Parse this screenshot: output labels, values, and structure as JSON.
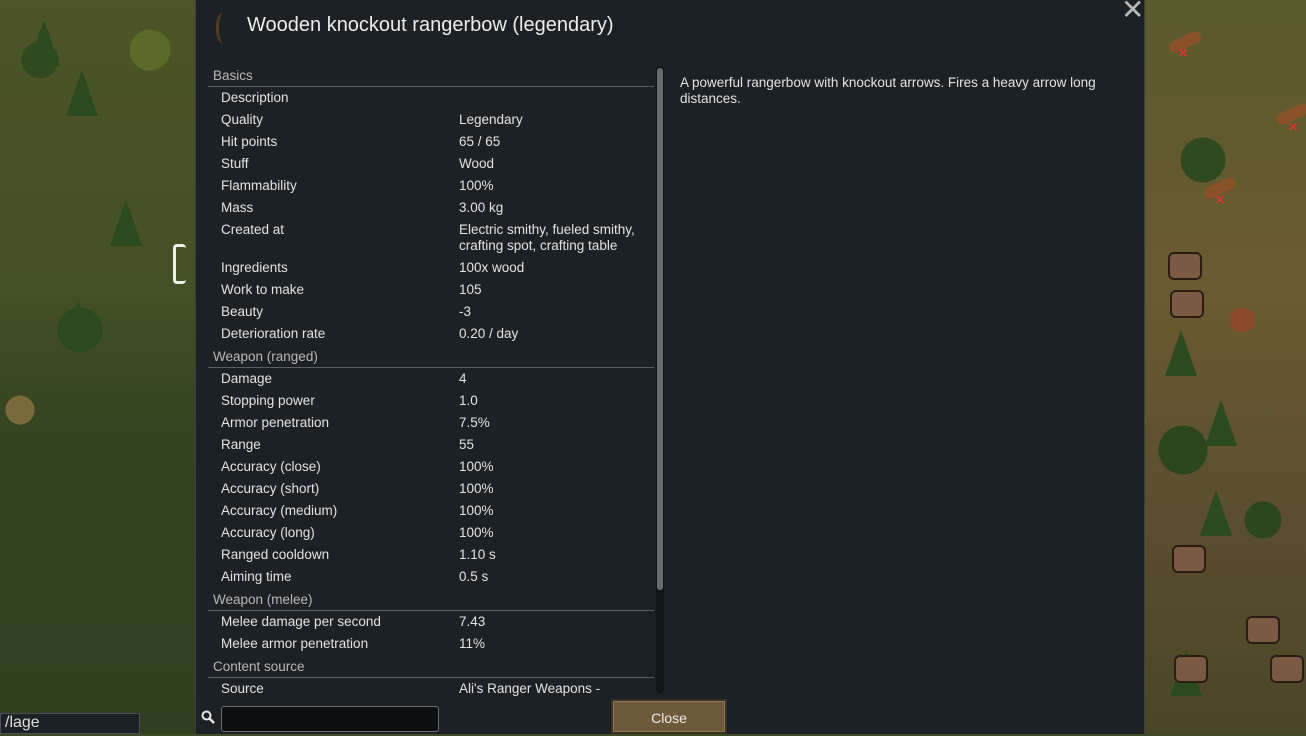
{
  "window": {
    "title": "Wooden knockout rangerbow (legendary)",
    "close_glyph": "✕",
    "icon": "rangerbow-icon"
  },
  "description": "A powerful rangerbow with knockout arrows. Fires a heavy arrow long distances.",
  "sections": [
    {
      "heading": "Basics",
      "rows": [
        {
          "label": "Description",
          "value": ""
        },
        {
          "label": "Quality",
          "value": "Legendary"
        },
        {
          "label": "Hit points",
          "value": "65 / 65"
        },
        {
          "label": "Stuff",
          "value": "Wood"
        },
        {
          "label": "Flammability",
          "value": "100%"
        },
        {
          "label": "Mass",
          "value": "3.00 kg"
        },
        {
          "label": "Created at",
          "value": "Electric smithy, fueled smithy, crafting spot, crafting table"
        },
        {
          "label": "Ingredients",
          "value": "100x wood"
        },
        {
          "label": "Work to make",
          "value": "105"
        },
        {
          "label": "Beauty",
          "value": "-3"
        },
        {
          "label": "Deterioration rate",
          "value": "0.20 / day"
        }
      ]
    },
    {
      "heading": "Weapon (ranged)",
      "rows": [
        {
          "label": "Damage",
          "value": "4"
        },
        {
          "label": "Stopping power",
          "value": "1.0"
        },
        {
          "label": "Armor penetration",
          "value": "7.5%"
        },
        {
          "label": "Range",
          "value": "55"
        },
        {
          "label": "Accuracy (close)",
          "value": "100%"
        },
        {
          "label": "Accuracy (short)",
          "value": "100%"
        },
        {
          "label": "Accuracy (medium)",
          "value": "100%"
        },
        {
          "label": "Accuracy (long)",
          "value": "100%"
        },
        {
          "label": "Ranged cooldown",
          "value": "1.10 s"
        },
        {
          "label": "Aiming time",
          "value": "0.5 s"
        }
      ]
    },
    {
      "heading": "Weapon (melee)",
      "rows": [
        {
          "label": "Melee damage per second",
          "value": "7.43"
        },
        {
          "label": "Melee armor penetration",
          "value": "11%"
        }
      ]
    },
    {
      "heading": "Content source",
      "rows": [
        {
          "label": "Source",
          "value": "Ali's Ranger Weapons -"
        }
      ]
    }
  ],
  "search": {
    "value": "",
    "icon": "search-icon"
  },
  "close_button": {
    "label": "Close"
  },
  "left_panel": {
    "text": "/lage"
  }
}
